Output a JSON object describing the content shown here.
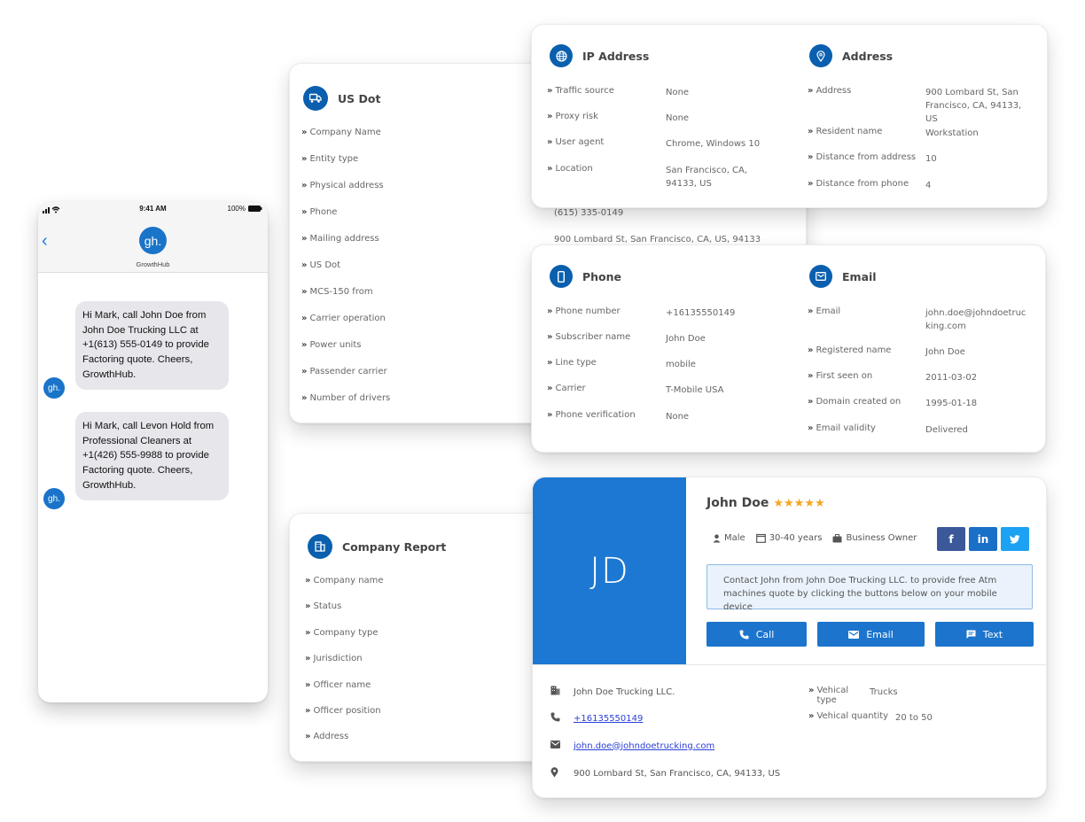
{
  "phone_mock": {
    "status_time": "9:41 AM",
    "battery": "100%",
    "back_icon": "chevron-left-icon",
    "sender_logo": "gh.",
    "sender_name": "GrowthHub",
    "messages": [
      {
        "text": "Hi Mark, call John Doe from John Doe Trucking LLC at +1(613) 555-0149 to provide Factoring quote. Cheers, GrowthHub.",
        "avatar": "gh."
      },
      {
        "text": "Hi Mark, call Levon Hold from Professional Cleaners at +1(426) 555-9988 to provide Factoring quote. Cheers, GrowthHub.",
        "avatar": "gh."
      }
    ]
  },
  "us_dot": {
    "title": "US Dot",
    "icon": "truck-icon",
    "rows": [
      {
        "label": "Company Name",
        "value": ""
      },
      {
        "label": "Entity type",
        "value": ""
      },
      {
        "label": "Physical address",
        "value": ""
      },
      {
        "label": "Phone",
        "value": "(615) 335-0149"
      },
      {
        "label": "Mailing address",
        "value": "900 Lombard St, San Francisco, CA, US, 94133"
      },
      {
        "label": "US Dot",
        "value": ""
      },
      {
        "label": "MCS-150 from",
        "value": ""
      },
      {
        "label": "Carrier operation",
        "value": ""
      },
      {
        "label": "Power units",
        "value": ""
      },
      {
        "label": "Passender carrier",
        "value": ""
      },
      {
        "label": "Number of drivers",
        "value": ""
      }
    ]
  },
  "ip_address": {
    "title": "IP Address",
    "icon": "globe-icon",
    "rows": [
      {
        "label": "Traffic source",
        "value": "None"
      },
      {
        "label": "Proxy risk",
        "value": "None"
      },
      {
        "label": "User agent",
        "value": "Chrome, Windows 10"
      },
      {
        "label": "Location",
        "value": "San Francisco, CA, 94133, US"
      }
    ]
  },
  "address": {
    "title": "Address",
    "icon": "map-pin-icon",
    "rows": [
      {
        "label": "Address",
        "value": "900 Lombard St, San Francisco, CA, 94133, US"
      },
      {
        "label": "Resident name",
        "value": "Workstation"
      },
      {
        "label": "Distance from address",
        "value": "10"
      },
      {
        "label": "Distance from phone",
        "value": "4"
      }
    ]
  },
  "phone": {
    "title": "Phone",
    "icon": "mobile-phone-icon",
    "rows": [
      {
        "label": "Phone number",
        "value": "+16135550149"
      },
      {
        "label": "Subscriber name",
        "value": "John Doe"
      },
      {
        "label": "Line type",
        "value": "mobile"
      },
      {
        "label": "Carrier",
        "value": "T-Mobile USA"
      },
      {
        "label": "Phone verification",
        "value": "None"
      }
    ]
  },
  "email": {
    "title": "Email",
    "icon": "envelope-icon",
    "rows": [
      {
        "label": "Email",
        "value": "john.doe@johndoetrucking.com"
      },
      {
        "label": "Registered name",
        "value": "John Doe"
      },
      {
        "label": "First seen on",
        "value": "2011-03-02"
      },
      {
        "label": "Domain created on",
        "value": "1995-01-18"
      },
      {
        "label": "Email validity",
        "value": "Delivered"
      }
    ]
  },
  "company_report": {
    "title": "Company Report",
    "icon": "building-icon",
    "rows": [
      {
        "label": "Company name"
      },
      {
        "label": "Status"
      },
      {
        "label": "Company type"
      },
      {
        "label": "Jurisdiction"
      },
      {
        "label": "Officer name"
      },
      {
        "label": "Officer position"
      },
      {
        "label": "Address"
      }
    ]
  },
  "profile": {
    "initials": "JD",
    "name": "John Doe",
    "rating": 5,
    "stars": "★★★★★",
    "gender": "Male",
    "age_range": "30-40 years",
    "occupation": "Business Owner",
    "social": {
      "facebook": "f",
      "linkedin": "in",
      "twitter": "t"
    },
    "notice": "Contact John from John Doe Trucking LLC. to provide free Atm machines quote by clicking the buttons below on your mobile device",
    "buttons": {
      "call": "Call",
      "email": "Email",
      "text": "Text"
    },
    "company": "John Doe Trucking LLC.",
    "phone": "+16135550149",
    "email": "john.doe@johndoetrucking.com",
    "address": "900 Lombard St, San Francisco, CA, 94133, US",
    "vehicle": [
      {
        "label": "Vehical type",
        "value": "Trucks"
      },
      {
        "label": "Vehical quantity",
        "value": "20 to 50"
      }
    ]
  },
  "colors": {
    "brand_blue": "#0a5fae",
    "profile_blue": "#1c78d2",
    "button_blue": "#1c74cc",
    "star": "#f5a623",
    "facebook": "#3b5998",
    "linkedin": "#1a6fc7",
    "twitter": "#1da1f2"
  }
}
